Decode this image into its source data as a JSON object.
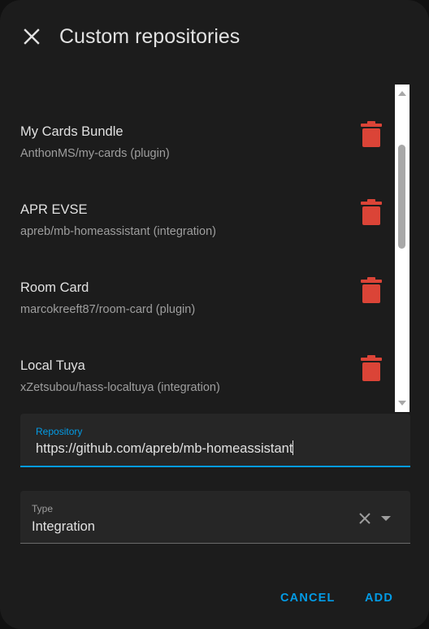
{
  "dialog": {
    "title": "Custom repositories"
  },
  "repositories": [
    {
      "name": "My Cards Bundle",
      "subtitle": "AnthonMS/my-cards (plugin)"
    },
    {
      "name": "APR EVSE",
      "subtitle": "apreb/mb-homeassistant (integration)"
    },
    {
      "name": "Room Card",
      "subtitle": "marcokreeft87/room-card (plugin)"
    },
    {
      "name": "Local Tuya",
      "subtitle": "xZetsubou/hass-localtuya (integration)"
    }
  ],
  "repository_field": {
    "label": "Repository",
    "value": "https://github.com/apreb/mb-homeassistant"
  },
  "type_field": {
    "label": "Type",
    "value": "Integration"
  },
  "actions": {
    "cancel": "CANCEL",
    "add": "ADD"
  },
  "colors": {
    "accent": "#039be5",
    "delete": "#db4437",
    "background": "#1c1c1c"
  },
  "icons": {
    "close": "close-icon",
    "delete": "trash-icon",
    "clear": "clear-icon",
    "dropdown": "chevron-down-icon"
  }
}
